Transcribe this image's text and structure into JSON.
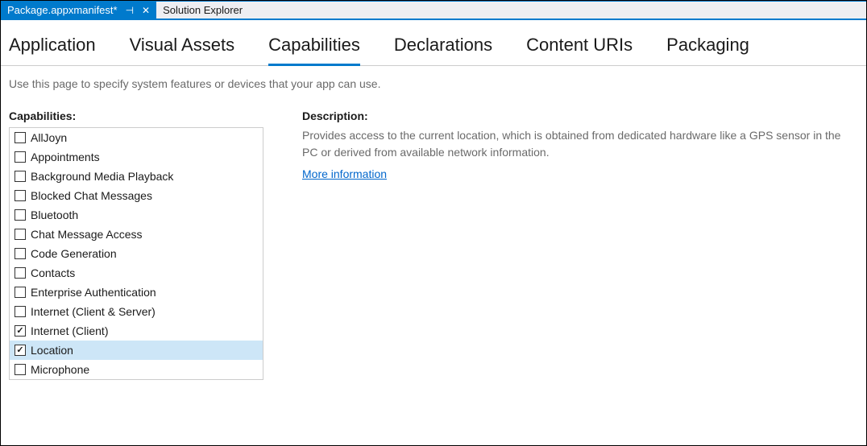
{
  "tabstrip": {
    "active_tab": "Package.appxmanifest*",
    "inactive_tab": "Solution Explorer"
  },
  "nav": {
    "tabs": [
      {
        "label": "Application",
        "active": false
      },
      {
        "label": "Visual Assets",
        "active": false
      },
      {
        "label": "Capabilities",
        "active": true
      },
      {
        "label": "Declarations",
        "active": false
      },
      {
        "label": "Content URIs",
        "active": false
      },
      {
        "label": "Packaging",
        "active": false
      }
    ]
  },
  "hint": "Use this page to specify system features or devices that your app can use.",
  "capabilities": {
    "heading": "Capabilities:",
    "items": [
      {
        "label": "AllJoyn",
        "checked": false,
        "selected": false
      },
      {
        "label": "Appointments",
        "checked": false,
        "selected": false
      },
      {
        "label": "Background Media Playback",
        "checked": false,
        "selected": false
      },
      {
        "label": "Blocked Chat Messages",
        "checked": false,
        "selected": false
      },
      {
        "label": "Bluetooth",
        "checked": false,
        "selected": false
      },
      {
        "label": "Chat Message Access",
        "checked": false,
        "selected": false
      },
      {
        "label": "Code Generation",
        "checked": false,
        "selected": false
      },
      {
        "label": "Contacts",
        "checked": false,
        "selected": false
      },
      {
        "label": "Enterprise Authentication",
        "checked": false,
        "selected": false
      },
      {
        "label": "Internet (Client & Server)",
        "checked": false,
        "selected": false
      },
      {
        "label": "Internet (Client)",
        "checked": true,
        "selected": false
      },
      {
        "label": "Location",
        "checked": true,
        "selected": true
      },
      {
        "label": "Microphone",
        "checked": false,
        "selected": false
      }
    ]
  },
  "description": {
    "heading": "Description:",
    "text": "Provides access to the current location, which is obtained from dedicated hardware like a GPS sensor in the PC or derived from available network information.",
    "link": "More information"
  }
}
